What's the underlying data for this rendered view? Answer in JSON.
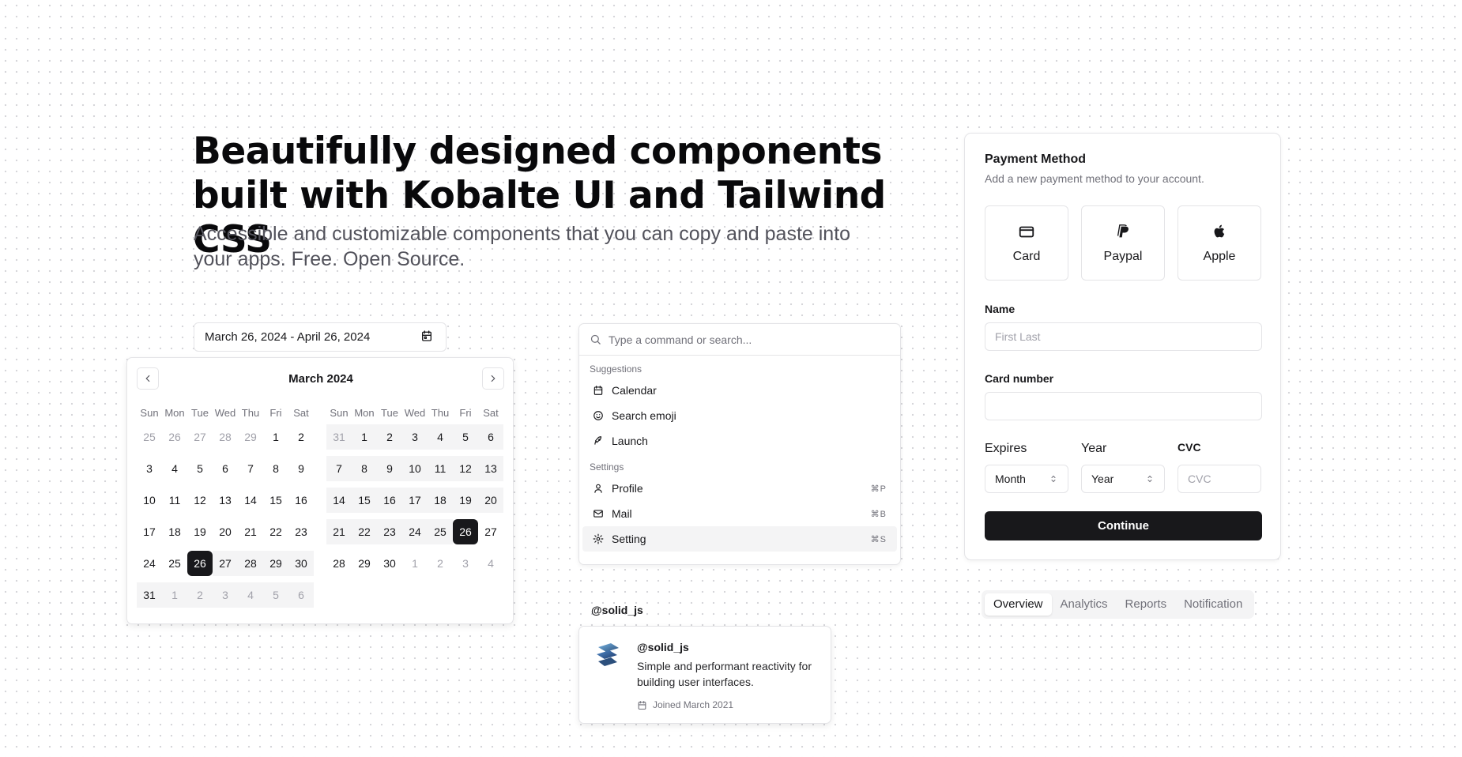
{
  "hero": {
    "title_line1": "Beautifully designed components",
    "title_line2": "built with Kobalte UI and Tailwind CSS",
    "subtitle": "Accessible and customizable components that you can copy and paste into your apps. Free. Open Source."
  },
  "date_range": {
    "value": "March 26, 2024 - April 26, 2024"
  },
  "calendar": {
    "title": "March 2024",
    "weekdays": [
      "Sun",
      "Mon",
      "Tue",
      "Wed",
      "Thu",
      "Fri",
      "Sat"
    ],
    "months": [
      {
        "name": "March 2024",
        "days": [
          {
            "d": "25",
            "s": "out"
          },
          {
            "d": "26",
            "s": "out"
          },
          {
            "d": "27",
            "s": "out"
          },
          {
            "d": "28",
            "s": "out"
          },
          {
            "d": "29",
            "s": "out"
          },
          {
            "d": "1",
            "s": ""
          },
          {
            "d": "2",
            "s": ""
          },
          {
            "d": "3",
            "s": ""
          },
          {
            "d": "4",
            "s": ""
          },
          {
            "d": "5",
            "s": ""
          },
          {
            "d": "6",
            "s": ""
          },
          {
            "d": "7",
            "s": ""
          },
          {
            "d": "8",
            "s": ""
          },
          {
            "d": "9",
            "s": ""
          },
          {
            "d": "10",
            "s": ""
          },
          {
            "d": "11",
            "s": ""
          },
          {
            "d": "12",
            "s": ""
          },
          {
            "d": "13",
            "s": ""
          },
          {
            "d": "14",
            "s": ""
          },
          {
            "d": "15",
            "s": ""
          },
          {
            "d": "16",
            "s": ""
          },
          {
            "d": "17",
            "s": ""
          },
          {
            "d": "18",
            "s": ""
          },
          {
            "d": "19",
            "s": ""
          },
          {
            "d": "20",
            "s": ""
          },
          {
            "d": "21",
            "s": ""
          },
          {
            "d": "22",
            "s": ""
          },
          {
            "d": "23",
            "s": ""
          },
          {
            "d": "24",
            "s": ""
          },
          {
            "d": "25",
            "s": ""
          },
          {
            "d": "26",
            "s": "sel"
          },
          {
            "d": "27",
            "s": "range"
          },
          {
            "d": "28",
            "s": "range"
          },
          {
            "d": "29",
            "s": "range"
          },
          {
            "d": "30",
            "s": "range"
          },
          {
            "d": "31",
            "s": "range"
          },
          {
            "d": "1",
            "s": "out range"
          },
          {
            "d": "2",
            "s": "out range"
          },
          {
            "d": "3",
            "s": "out range"
          },
          {
            "d": "4",
            "s": "out range"
          },
          {
            "d": "5",
            "s": "out range"
          },
          {
            "d": "6",
            "s": "out range"
          }
        ]
      },
      {
        "name": "April 2024",
        "days": [
          {
            "d": "31",
            "s": "out range"
          },
          {
            "d": "1",
            "s": "range"
          },
          {
            "d": "2",
            "s": "range"
          },
          {
            "d": "3",
            "s": "range"
          },
          {
            "d": "4",
            "s": "range"
          },
          {
            "d": "5",
            "s": "range"
          },
          {
            "d": "6",
            "s": "range"
          },
          {
            "d": "7",
            "s": "range"
          },
          {
            "d": "8",
            "s": "range"
          },
          {
            "d": "9",
            "s": "range"
          },
          {
            "d": "10",
            "s": "range"
          },
          {
            "d": "11",
            "s": "range"
          },
          {
            "d": "12",
            "s": "range"
          },
          {
            "d": "13",
            "s": "range"
          },
          {
            "d": "14",
            "s": "range"
          },
          {
            "d": "15",
            "s": "range"
          },
          {
            "d": "16",
            "s": "range"
          },
          {
            "d": "17",
            "s": "range"
          },
          {
            "d": "18",
            "s": "range"
          },
          {
            "d": "19",
            "s": "range"
          },
          {
            "d": "20",
            "s": "range"
          },
          {
            "d": "21",
            "s": "range"
          },
          {
            "d": "22",
            "s": "range"
          },
          {
            "d": "23",
            "s": "range"
          },
          {
            "d": "24",
            "s": "range"
          },
          {
            "d": "25",
            "s": "range"
          },
          {
            "d": "26",
            "s": "sel"
          },
          {
            "d": "27",
            "s": ""
          },
          {
            "d": "28",
            "s": ""
          },
          {
            "d": "29",
            "s": ""
          },
          {
            "d": "30",
            "s": ""
          },
          {
            "d": "1",
            "s": "out"
          },
          {
            "d": "2",
            "s": "out"
          },
          {
            "d": "3",
            "s": "out"
          },
          {
            "d": "4",
            "s": "out"
          }
        ]
      }
    ]
  },
  "command": {
    "placeholder": "Type a command or search...",
    "suggestions_label": "Suggestions",
    "suggestions": [
      {
        "label": "Calendar",
        "icon": "calendar-icon"
      },
      {
        "label": "Search emoji",
        "icon": "smile-icon"
      },
      {
        "label": "Launch",
        "icon": "rocket-icon"
      }
    ],
    "settings_label": "Settings",
    "settings": [
      {
        "label": "Profile",
        "icon": "user-icon",
        "shortcut": "⌘P"
      },
      {
        "label": "Mail",
        "icon": "mail-icon",
        "shortcut": "⌘B"
      },
      {
        "label": "Setting",
        "icon": "gear-icon",
        "shortcut": "⌘S"
      }
    ]
  },
  "hover_card": {
    "trigger": "@solid_js",
    "handle": "@solid_js",
    "description": "Simple and performant reactivity for building user interfaces.",
    "joined": "Joined March 2021"
  },
  "payment": {
    "title": "Payment Method",
    "description": "Add a new payment method to your account.",
    "options": [
      "Card",
      "Paypal",
      "Apple"
    ],
    "name_label": "Name",
    "name_placeholder": "First Last",
    "card_label": "Card number",
    "card_value": "",
    "expires_label": "Expires",
    "month_value": "Month",
    "year_label": "Year",
    "year_value": "Year",
    "cvc_label": "CVC",
    "cvc_placeholder": "CVC",
    "continue_label": "Continue"
  },
  "tabs": {
    "items": [
      "Overview",
      "Analytics",
      "Reports",
      "Notification"
    ],
    "active": "Overview"
  }
}
